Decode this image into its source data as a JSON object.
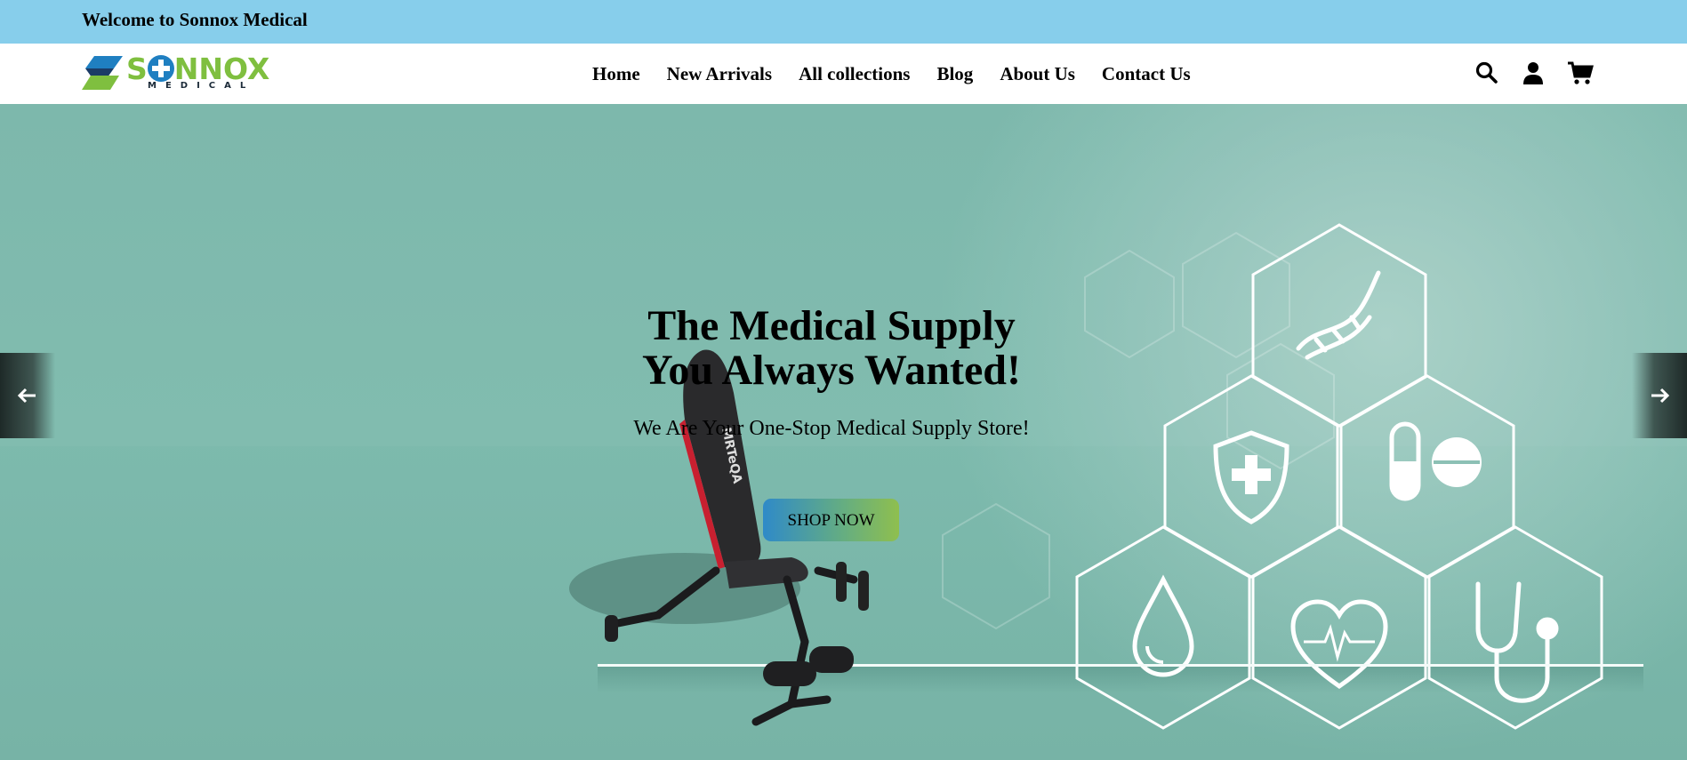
{
  "topbar": {
    "welcome": "Welcome to Sonnox Medical"
  },
  "brand": {
    "name_part1": "S",
    "name_part2": "NN",
    "name_part3": "OX",
    "subtitle": "MEDICAL",
    "colors": {
      "green": "#7fbf3f",
      "blue": "#1f7fc1",
      "dark": "#1b2a38"
    }
  },
  "nav": {
    "items": [
      {
        "label": "Home"
      },
      {
        "label": "New Arrivals"
      },
      {
        "label": "All collections"
      },
      {
        "label": "Blog"
      },
      {
        "label": "About Us"
      },
      {
        "label": "Contact Us"
      }
    ]
  },
  "header_icons": [
    "search-icon",
    "user-icon",
    "cart-icon"
  ],
  "hero": {
    "title_line1": "The Medical Supply",
    "title_line2": "You Always Wanted!",
    "subtitle": "We Are Your One-Stop Medical Supply Store!",
    "cta": "SHOP NOW",
    "bench_brand": "MRTeQA",
    "hex_icons": [
      "dna-icon",
      "shield-cross-icon",
      "pills-icon",
      "drop-icon",
      "heart-pulse-icon",
      "stethoscope-icon"
    ]
  },
  "colors": {
    "topbar": "#87ceeb",
    "hero_bg": "#7eb8ab",
    "button_gradient_start": "#2f8ac8",
    "button_gradient_end": "#8fbf4e"
  }
}
